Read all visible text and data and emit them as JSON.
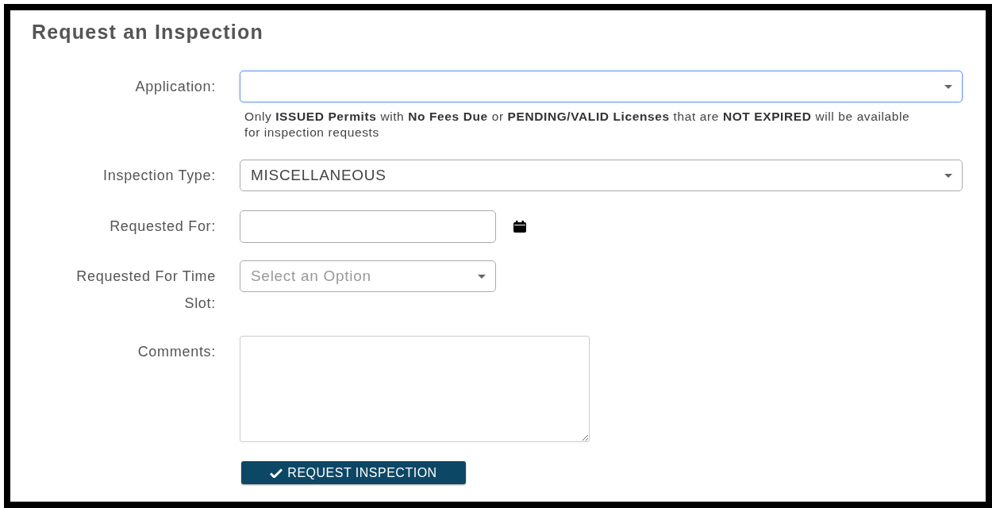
{
  "title": "Request an Inspection",
  "fields": [
    {
      "kind": "select",
      "label": "Application:",
      "focused": true,
      "help": "Only **ISSUED Permits** with **No Fees Due** or **PENDING/VALID Licenses** that are **NOT EXPIRED** will be available for inspection requests"
    },
    {
      "kind": "select",
      "label": "Inspection Type:",
      "focused": false,
      "value": "MISCELLANEOUS"
    },
    {
      "kind": "date",
      "label": "Requested For:",
      "focused": false
    },
    {
      "kind": "select",
      "label": "Requested For Time Slot:",
      "focused": false,
      "placeholder": "Select an Option",
      "narrow": true
    },
    {
      "kind": "textarea",
      "label": "Comments:",
      "focused": false
    }
  ],
  "button": {
    "label": "REQUEST INSPECTION"
  }
}
